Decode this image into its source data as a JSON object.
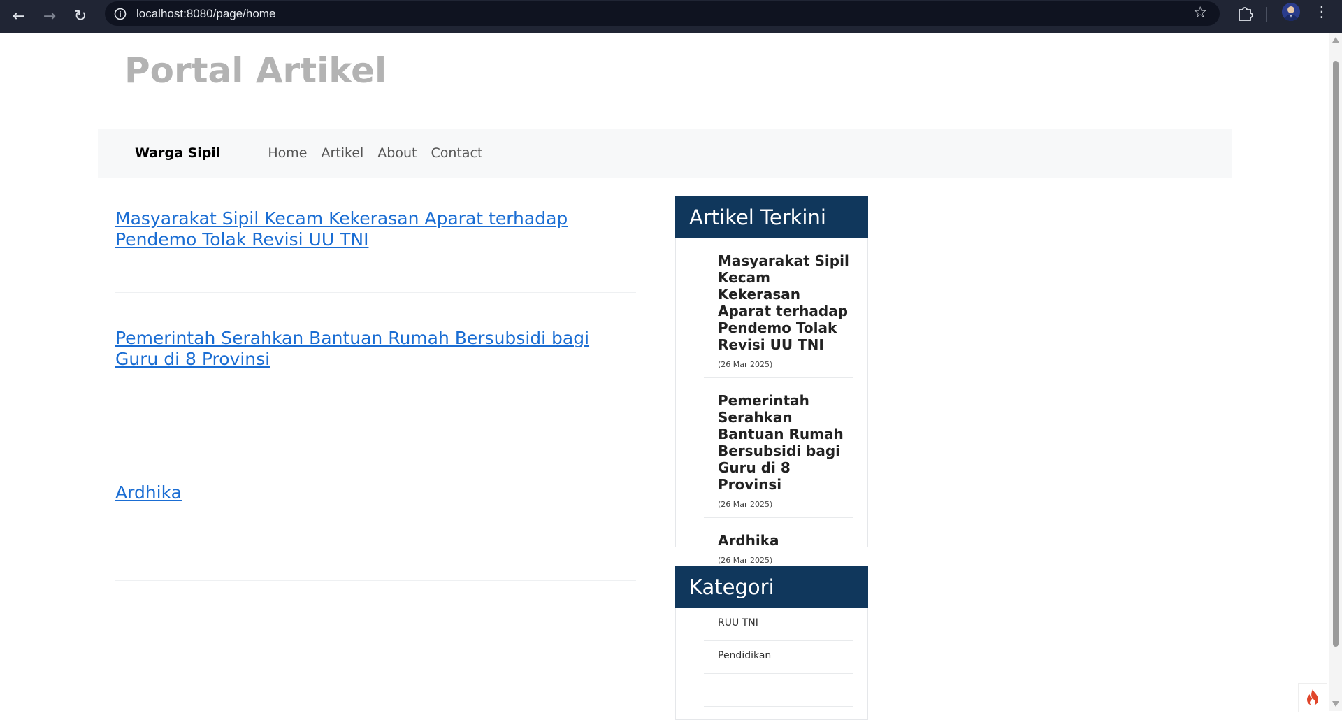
{
  "browser": {
    "url": "localhost:8080/page/home",
    "icons": [
      "back-arrow-icon",
      "forward-arrow-icon",
      "reload-icon",
      "site-info-icon",
      "bookmark-star-icon",
      "extensions-icon",
      "profile-avatar",
      "menu-icon"
    ]
  },
  "site": {
    "title": "Portal Artikel"
  },
  "navbar": {
    "brand": "Warga Sipil",
    "links": [
      "Home",
      "Artikel",
      "About",
      "Contact"
    ]
  },
  "articles": [
    "Masyarakat Sipil Kecam Kekerasan Aparat terhadap Pendemo Tolak Revisi UU TNI",
    "Pemerintah Serahkan Bantuan Rumah Bersubsidi bagi Guru di 8 Provinsi",
    "Ardhika"
  ],
  "sidebar": {
    "recent_title": "Artikel Terkini",
    "recent": [
      {
        "title": "Masyarakat Sipil Kecam Kekerasan Aparat terhadap Pendemo Tolak Revisi UU TNI",
        "date": "(26 Mar 2025)"
      },
      {
        "title": "Pemerintah Serahkan Bantuan Rumah Bersubsidi bagi Guru di 8 Provinsi",
        "date": "(26 Mar 2025)"
      },
      {
        "title": "Ardhika",
        "date": "(26 Mar 2025)"
      }
    ],
    "category_title": "Kategori",
    "categories": [
      "RUU TNI",
      "Pendidikan",
      ""
    ]
  },
  "colors": {
    "chrome": "#202534",
    "link": "#1a6dd3",
    "widget_header": "#10375c",
    "site_title": "#b3b3b3"
  }
}
